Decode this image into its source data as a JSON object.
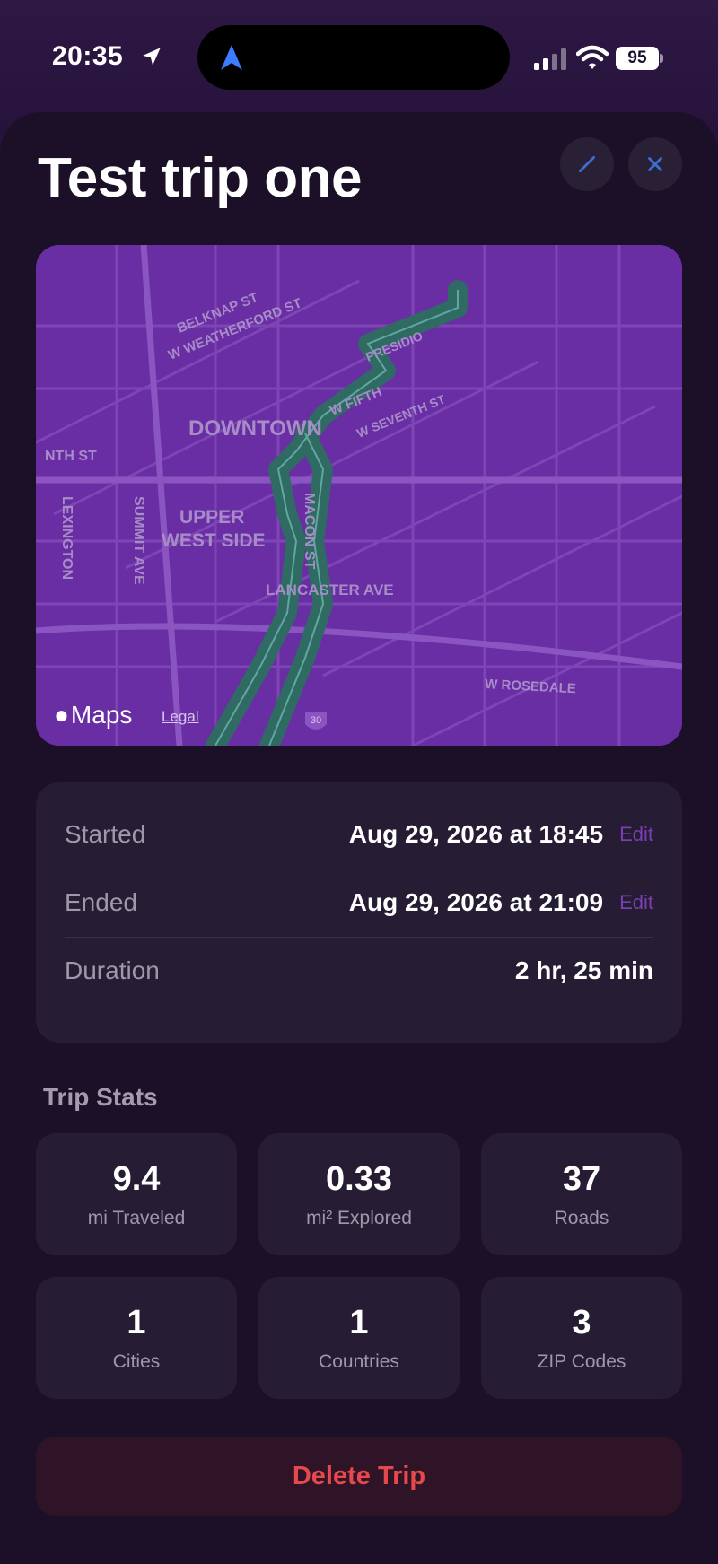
{
  "status_bar": {
    "time": "20:35",
    "battery": "95"
  },
  "trip": {
    "title": "Test trip one"
  },
  "map": {
    "attribution": "Maps",
    "legal": "Legal",
    "labels": {
      "downtown": "DOWNTOWN",
      "upper": "UPPER",
      "west_side": "WEST SIDE",
      "macon": "MACON ST",
      "lancaster": "LANCASTER AVE",
      "fifth": "W FIFTH",
      "belknap": "BELKNAP ST",
      "weatherford": "W WEATHERFORD ST",
      "summit": "SUMMIT AVE",
      "nth": "NTH ST",
      "lexington": "LEXINGTON",
      "presidio": "PRESIDIO",
      "seventh": "W SEVENTH ST",
      "rosedale": "W ROSEDALE",
      "interstate": "30"
    }
  },
  "times": {
    "started_label": "Started",
    "started_value": "Aug 29, 2026 at 18:45",
    "ended_label": "Ended",
    "ended_value": "Aug 29, 2026 at 21:09",
    "duration_label": "Duration",
    "duration_value": "2 hr, 25 min",
    "edit_label": "Edit"
  },
  "stats": {
    "heading": "Trip Stats",
    "items": [
      {
        "value": "9.4",
        "label": "mi Traveled"
      },
      {
        "value": "0.33",
        "label": "mi² Explored"
      },
      {
        "value": "37",
        "label": "Roads"
      },
      {
        "value": "1",
        "label": "Cities"
      },
      {
        "value": "1",
        "label": "Countries"
      },
      {
        "value": "3",
        "label": "ZIP Codes"
      }
    ]
  },
  "actions": {
    "delete": "Delete Trip"
  },
  "colors": {
    "accent": "#7a3fb2",
    "map_bg": "#6a2ea4",
    "route": "#2f6a63",
    "danger": "#e5484d"
  }
}
